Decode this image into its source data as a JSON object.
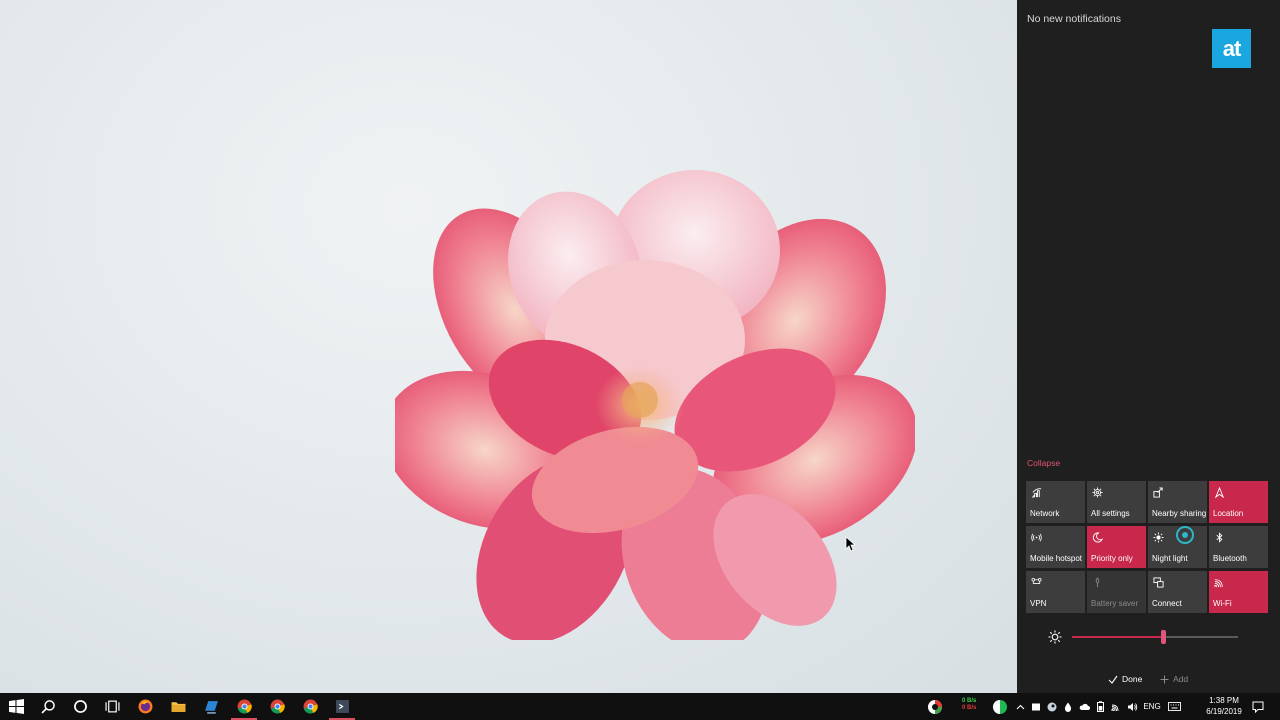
{
  "action_center": {
    "notifications_header": "No new notifications",
    "brand_logo_text": "at",
    "collapse_label": "Collapse",
    "tiles": [
      {
        "label": "Network",
        "icon": "network-icon",
        "state": "off"
      },
      {
        "label": "All settings",
        "icon": "gear-icon",
        "state": "off"
      },
      {
        "label": "Nearby sharing",
        "icon": "share-icon",
        "state": "off"
      },
      {
        "label": "Location",
        "icon": "location-icon",
        "state": "on"
      },
      {
        "label": "Mobile hotspot",
        "icon": "hotspot-icon",
        "state": "off"
      },
      {
        "label": "Priority only",
        "icon": "moon-icon",
        "state": "on"
      },
      {
        "label": "Night light",
        "icon": "sun-icon",
        "state": "off"
      },
      {
        "label": "Bluetooth",
        "icon": "bluetooth-icon",
        "state": "off"
      },
      {
        "label": "VPN",
        "icon": "vpn-icon",
        "state": "off"
      },
      {
        "label": "Battery saver",
        "icon": "battery-saver-icon",
        "state": "disabled"
      },
      {
        "label": "Connect",
        "icon": "cast-icon",
        "state": "off"
      },
      {
        "label": "Wi-Fi",
        "icon": "wifi-icon",
        "state": "on"
      }
    ],
    "brightness_fraction": 0.55,
    "done_label": "Done",
    "add_label": "Add"
  },
  "taskbar": {
    "net_speed_up": "0 B/s",
    "net_speed_down": "0 B/s",
    "language": "ENG",
    "clock_time": "1:38 PM",
    "clock_date": "6/19/2019"
  },
  "colors": {
    "accent": "#c7284b",
    "panel_bg": "#1f1f1f",
    "tile_bg": "#3d3d3d",
    "brand": "#1aa7e0",
    "taskbar_bg": "#101010"
  }
}
